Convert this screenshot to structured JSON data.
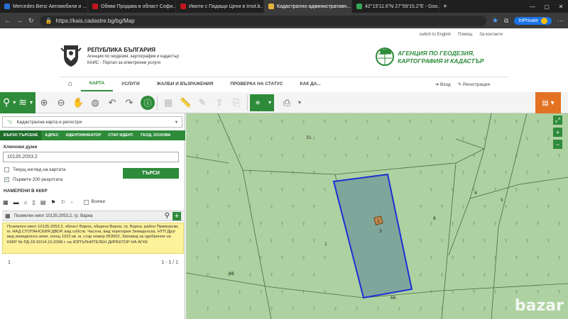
{
  "browser": {
    "tabs": [
      {
        "title": "Mercedes Benz Автомобили и ...",
        "color": "#2a6fd6",
        "active": false
      },
      {
        "title": "Обяви Продава в област Софи...",
        "color": "#c4161c",
        "active": false
      },
      {
        "title": "Имоти с Падащи Цени в Imot.b...",
        "color": "#c4161c",
        "active": false
      },
      {
        "title": "Кадастрално-административн...",
        "color": "#e9b23a",
        "active": true
      },
      {
        "title": "42°15'11.6\"N 27°59'15.2\"E - Goo...",
        "color": "#34a853",
        "active": false
      }
    ],
    "url": "https://kais.cadastre.bg/bg/Map",
    "profile": "InPrivate"
  },
  "site": {
    "top_links": [
      "switch to English",
      "Помощ",
      "За контакти"
    ],
    "org_title": "РЕПУБЛИКА БЪЛГАРИЯ",
    "org_sub": "Агенция по геодезия, картография и кадастър",
    "org_sub2": "КАИС - Портал за електронни услуги",
    "agency_line1": "АГЕНЦИЯ ПО ГЕОДЕЗИЯ,",
    "agency_line2": "КАРТОГРАФИЯ И КАДАСТЪР",
    "nav": [
      "КАРТА",
      "УСЛУГИ",
      "ЖАЛБИ И ВЪЗРАЖЕНИЯ",
      "ПРОВЕРКА НА СТАТУС",
      "КАК ДА..."
    ],
    "login": "Вход",
    "register": "Регистрация"
  },
  "panel": {
    "layer": "Кадастрална карта и регистри",
    "search_tabs": [
      "БЪРЗО ТЪРСЕНЕ",
      "АДРЕС",
      "ИДЕНТИФИКАТОР",
      "СТАР ИДЕНТ.",
      "ГЕОД. ОСНОВА"
    ],
    "keywords_label": "Ключови думи",
    "keywords_value": "10135.2053.2",
    "check_current": "Текущ изглед на картата",
    "check_first200": "Първите 200 резултата",
    "search_button": "ТЪРСИ",
    "found_label": "НАМЕРЕНИ В КККР",
    "filter_all": "Всички",
    "result_title": "Поземлен имот 10135.2053.2, гр. Варна",
    "result_text": "Поземлен имот 10135.2053.2, област Варна, община Варна, гр. Варна, район Приморски, м. НАД СТОПАНСКИЯ ДВОР, вид собств. Частна, вид територия Земеделска, НТП Друг вид земеделска земя, площ 1023 кв. м, стар номер 053002, Заповед за одобрение на КККР № РД-18-92/14.10.2008 г. на ИЗПЪЛНИТЕЛЕН ДИРЕКТОР НА АГКК",
    "page_current": "1",
    "page_range": "1 - 1 / 1"
  },
  "map": {
    "labels": [
      "31",
      "4",
      "5",
      "8",
      "1",
      "3",
      "2",
      "66",
      "98"
    ],
    "watermark": "bazar"
  },
  "colors": {
    "brand_green": "#2e8b3a",
    "map_bg": "#aed1a1",
    "selected_fill": "#7fa69b",
    "selected_stroke": "#1c2fd6",
    "result_bg": "#fdf19a",
    "accent_orange": "#e37222"
  }
}
